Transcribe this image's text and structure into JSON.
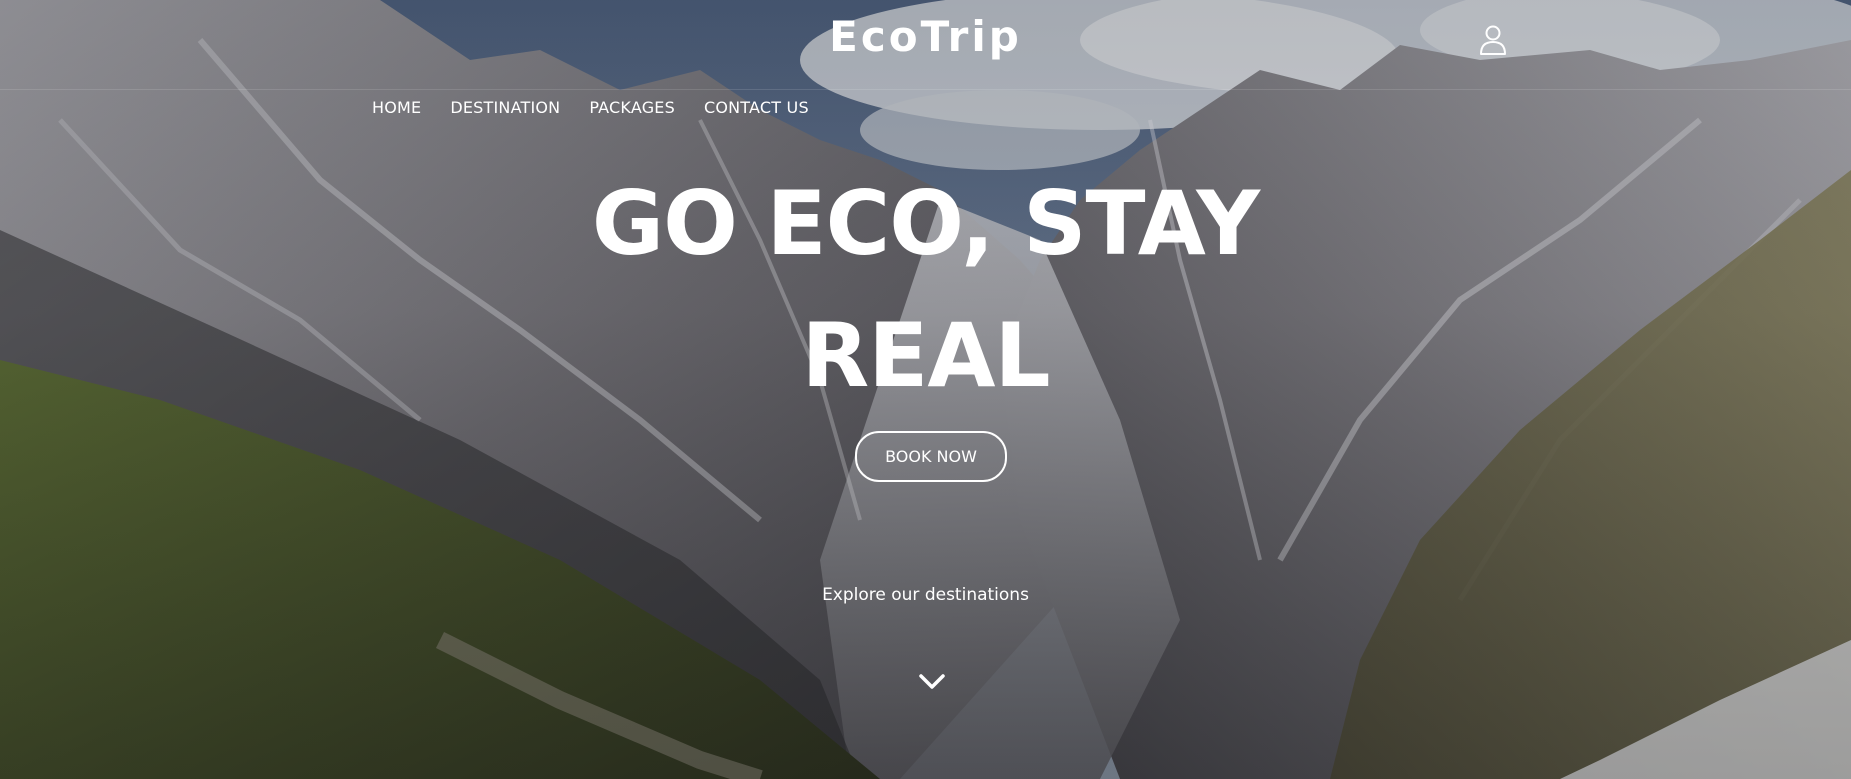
{
  "brand": {
    "logo_text": "EcoTrip"
  },
  "header": {
    "user_icon": "user-icon"
  },
  "nav": {
    "items": [
      {
        "label": "HOME"
      },
      {
        "label": "DESTINATION"
      },
      {
        "label": "PACKAGES"
      },
      {
        "label": "CONTACT US"
      }
    ]
  },
  "hero": {
    "headline_line1": "GO ECO, STAY",
    "headline_line2": "REAL",
    "cta_label": "BOOK NOW",
    "explore_text": "Explore our destinations",
    "scroll_icon": "chevron-down-icon",
    "background_icon": "mountain-landscape-photo"
  },
  "colors": {
    "text": "#ffffff",
    "sky": "#5b6f8c",
    "rock": "#6e6c70",
    "grass": "#5a6a3a"
  }
}
